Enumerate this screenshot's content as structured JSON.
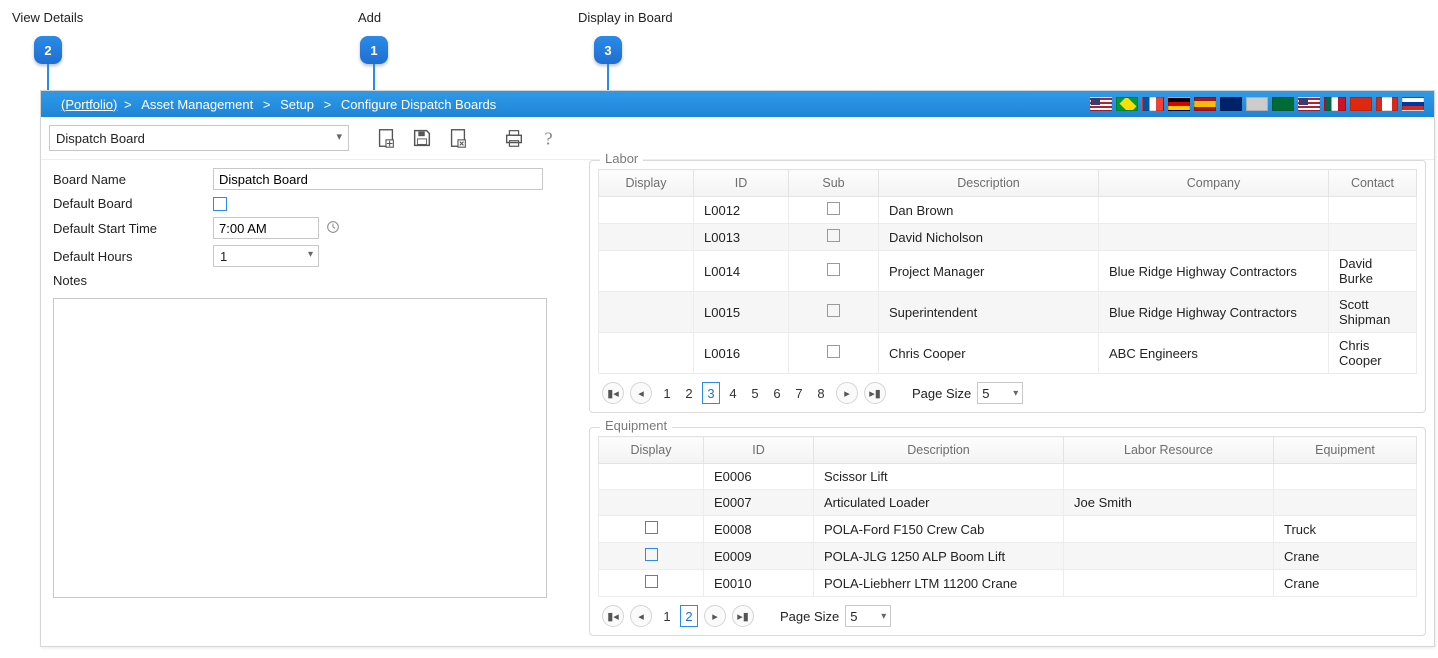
{
  "callouts": {
    "c1": {
      "label": "Add",
      "num": "1"
    },
    "c2": {
      "label": "View Details",
      "num": "2"
    },
    "c3": {
      "label": "Display in Board",
      "num": "3"
    }
  },
  "breadcrumb": {
    "root": "(Portfolio)",
    "parts": [
      "Asset Management",
      "Setup",
      "Configure Dispatch Boards"
    ],
    "sep": ">"
  },
  "toolbar": {
    "board_select_value": "Dispatch Board"
  },
  "form": {
    "board_name_label": "Board Name",
    "board_name_value": "Dispatch Board",
    "default_board_label": "Default Board",
    "default_board_checked": false,
    "default_start_time_label": "Default Start Time",
    "default_start_time_value": "7:00 AM",
    "default_hours_label": "Default Hours",
    "default_hours_value": "1",
    "notes_label": "Notes",
    "notes_value": ""
  },
  "labor": {
    "legend": "Labor",
    "columns": [
      "Display",
      "ID",
      "Sub",
      "Description",
      "Company",
      "Contact"
    ],
    "rows": [
      {
        "display": null,
        "id": "L0012",
        "sub": false,
        "desc": "Dan Brown",
        "company": "",
        "contact": ""
      },
      {
        "display": null,
        "id": "L0013",
        "sub": false,
        "desc": "David Nicholson",
        "company": "",
        "contact": ""
      },
      {
        "display": null,
        "id": "L0014",
        "sub": false,
        "desc": "Project Manager",
        "company": "Blue Ridge Highway Contractors",
        "contact": "David Burke"
      },
      {
        "display": null,
        "id": "L0015",
        "sub": false,
        "desc": "Superintendent",
        "company": "Blue Ridge Highway Contractors",
        "contact": "Scott Shipman"
      },
      {
        "display": null,
        "id": "L0016",
        "sub": false,
        "desc": "Chris Cooper",
        "company": "ABC Engineers",
        "contact": "Chris Cooper"
      }
    ],
    "pager": {
      "pages": [
        "1",
        "2",
        "3",
        "4",
        "5",
        "6",
        "7",
        "8"
      ],
      "current": "3",
      "page_size_label": "Page Size",
      "page_size_value": "5"
    }
  },
  "equipment": {
    "legend": "Equipment",
    "columns": [
      "Display",
      "ID",
      "Description",
      "Labor Resource",
      "Equipment"
    ],
    "rows": [
      {
        "display": null,
        "id": "E0006",
        "desc": "Scissor Lift",
        "labor": "",
        "equip": ""
      },
      {
        "display": null,
        "id": "E0007",
        "desc": "Articulated Loader",
        "labor": "Joe Smith",
        "equip": ""
      },
      {
        "display": "blue",
        "id": "E0008",
        "desc": "POLA-Ford F150 Crew Cab",
        "labor": "",
        "equip": "Truck"
      },
      {
        "display": "blue",
        "id": "E0009",
        "desc": "POLA-JLG 1250 ALP Boom Lift",
        "labor": "",
        "equip": "Crane"
      },
      {
        "display": "blue",
        "id": "E0010",
        "desc": "POLA-Liebherr LTM 11200 Crane",
        "labor": "",
        "equip": "Crane"
      }
    ],
    "pager": {
      "pages": [
        "1",
        "2"
      ],
      "current": "2",
      "page_size_label": "Page Size",
      "page_size_value": "5"
    }
  }
}
